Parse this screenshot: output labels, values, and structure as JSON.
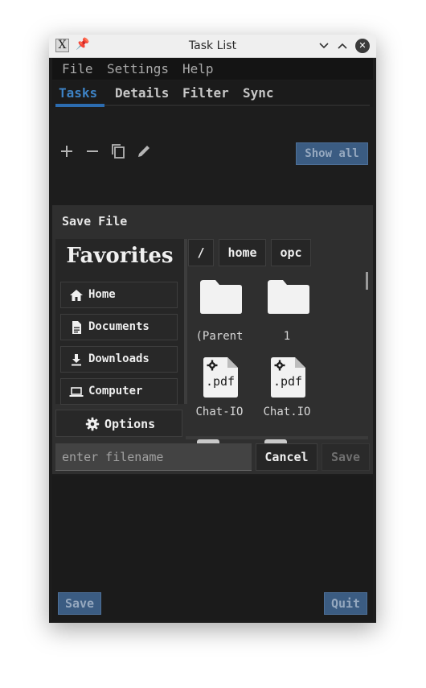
{
  "window": {
    "title": "Task List",
    "app_icon": "X"
  },
  "menu": {
    "items": [
      "File",
      "Settings",
      "Help"
    ]
  },
  "tabs": {
    "items": [
      "Tasks",
      "Details",
      "Filter",
      "Sync"
    ],
    "active": 0
  },
  "toolbar": {
    "icons": [
      "add-icon",
      "remove-icon",
      "copy-icon",
      "edit-icon"
    ],
    "show_all_label": "Show all"
  },
  "dialog": {
    "title": "Save File",
    "favorites": {
      "heading": "Favorites",
      "items": [
        {
          "label": "Home",
          "icon": "home-icon"
        },
        {
          "label": "Documents",
          "icon": "document-icon"
        },
        {
          "label": "Downloads",
          "icon": "download-icon"
        },
        {
          "label": "Computer",
          "icon": "laptop-icon"
        }
      ]
    },
    "options_label": "Options",
    "breadcrumbs": [
      "/",
      "home",
      "opc"
    ],
    "files": [
      {
        "name": "(Parent",
        "type": "folder"
      },
      {
        "name": "1",
        "type": "folder"
      },
      {
        "name": "Chat-IO",
        "type": "pdf",
        "ext": ".pdf"
      },
      {
        "name": "Chat.IO",
        "type": "pdf",
        "ext": ".pdf"
      }
    ],
    "filename_placeholder": "enter filename",
    "cancel_label": "Cancel",
    "save_label": "Save"
  },
  "footer": {
    "save_label": "Save",
    "quit_label": "Quit"
  },
  "colors": {
    "accent": "#3d82c4",
    "button_blue": "#3b5c82",
    "window_bg": "#1d1d1d",
    "dialog_bg": "#2f2f2f"
  }
}
